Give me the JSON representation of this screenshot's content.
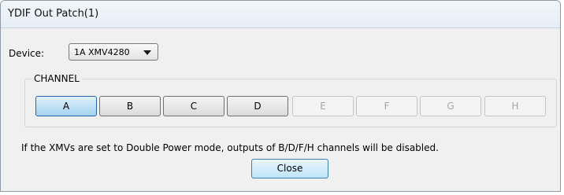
{
  "window": {
    "title": "YDIF Out Patch(1)"
  },
  "device": {
    "label": "Device:",
    "selected": "1A XMV4280",
    "arrow_icon": "triangle-down"
  },
  "channel_group": {
    "label": "CHANNEL",
    "channels": [
      {
        "label": "A",
        "state": "selected"
      },
      {
        "label": "B",
        "state": "enabled"
      },
      {
        "label": "C",
        "state": "enabled"
      },
      {
        "label": "D",
        "state": "enabled"
      },
      {
        "label": "E",
        "state": "disabled"
      },
      {
        "label": "F",
        "state": "disabled"
      },
      {
        "label": "G",
        "state": "disabled"
      },
      {
        "label": "H",
        "state": "disabled"
      }
    ]
  },
  "notice": "If the XMVs are set to Double Power mode, outputs of  B/D/F/H channels will be disabled.",
  "buttons": {
    "close": "Close"
  },
  "colors": {
    "selected_channel": "#a4d2f0",
    "disabled_text": "#a6a6a6",
    "focus_border": "#3c7fb1"
  }
}
